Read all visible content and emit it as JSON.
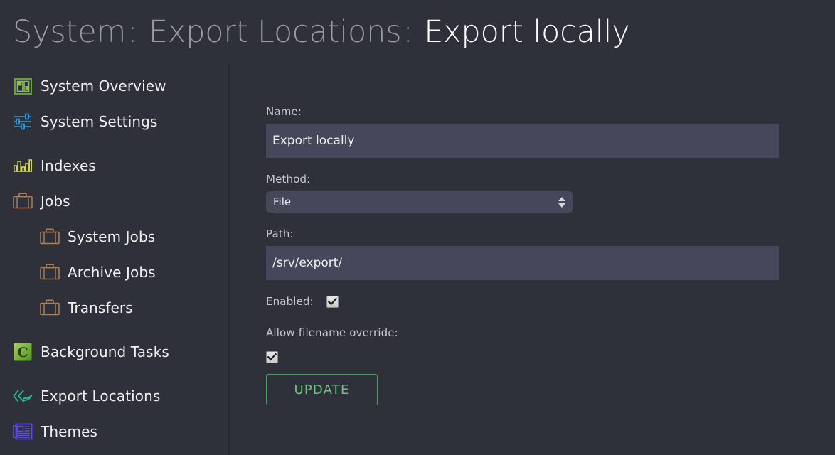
{
  "header": {
    "breadcrumb": [
      "System",
      "Export Locations",
      "Export locally"
    ],
    "separator": ":",
    "crumb_1": "System",
    "crumb_2": "Export Locations",
    "crumb_3": "Export locally",
    "sep_1": ":",
    "sep_2": ":"
  },
  "sidebar": {
    "items": [
      {
        "label": "System Overview",
        "icon": "system-overview-icon",
        "color": "#8cc257",
        "indent": false
      },
      {
        "label": "System Settings",
        "icon": "sliders-icon",
        "color": "#2f8fd0",
        "indent": false
      },
      {
        "label": "Indexes",
        "icon": "bar-chart-icon",
        "color": "#d6d84a",
        "indent": false
      },
      {
        "label": "Jobs",
        "icon": "briefcase-icon",
        "color": "#a9815c",
        "indent": false
      },
      {
        "label": "System Jobs",
        "icon": "briefcase-icon",
        "color": "#a9815c",
        "indent": true
      },
      {
        "label": "Archive Jobs",
        "icon": "briefcase-icon",
        "color": "#a9815c",
        "indent": true
      },
      {
        "label": "Transfers",
        "icon": "briefcase-icon",
        "color": "#a9815c",
        "indent": true
      },
      {
        "label": "Background Tasks",
        "icon": "celery-c-icon",
        "color": "#7bbf3e",
        "indent": false
      },
      {
        "label": "Export Locations",
        "icon": "reply-all-arrow-icon",
        "color": "#2bb79a",
        "indent": false
      },
      {
        "label": "Themes",
        "icon": "newspaper-icon",
        "color": "#5b4de0",
        "indent": false
      }
    ]
  },
  "form": {
    "name": {
      "label": "Name:",
      "value": "Export locally",
      "placeholder": ""
    },
    "method": {
      "label": "Method:",
      "value": "File",
      "options": [
        "File"
      ]
    },
    "path": {
      "label": "Path:",
      "value": "/srv/export/",
      "placeholder": ""
    },
    "enabled": {
      "label": "Enabled:",
      "checked": true
    },
    "allow_filename_override": {
      "label": "Allow filename override:",
      "checked": true
    },
    "update_button": "UPDATE"
  },
  "colors": {
    "page_background": "#2e303a",
    "input_background": "#45475a",
    "accent_green": "#70c184",
    "muted_text": "#9a9aa2"
  }
}
